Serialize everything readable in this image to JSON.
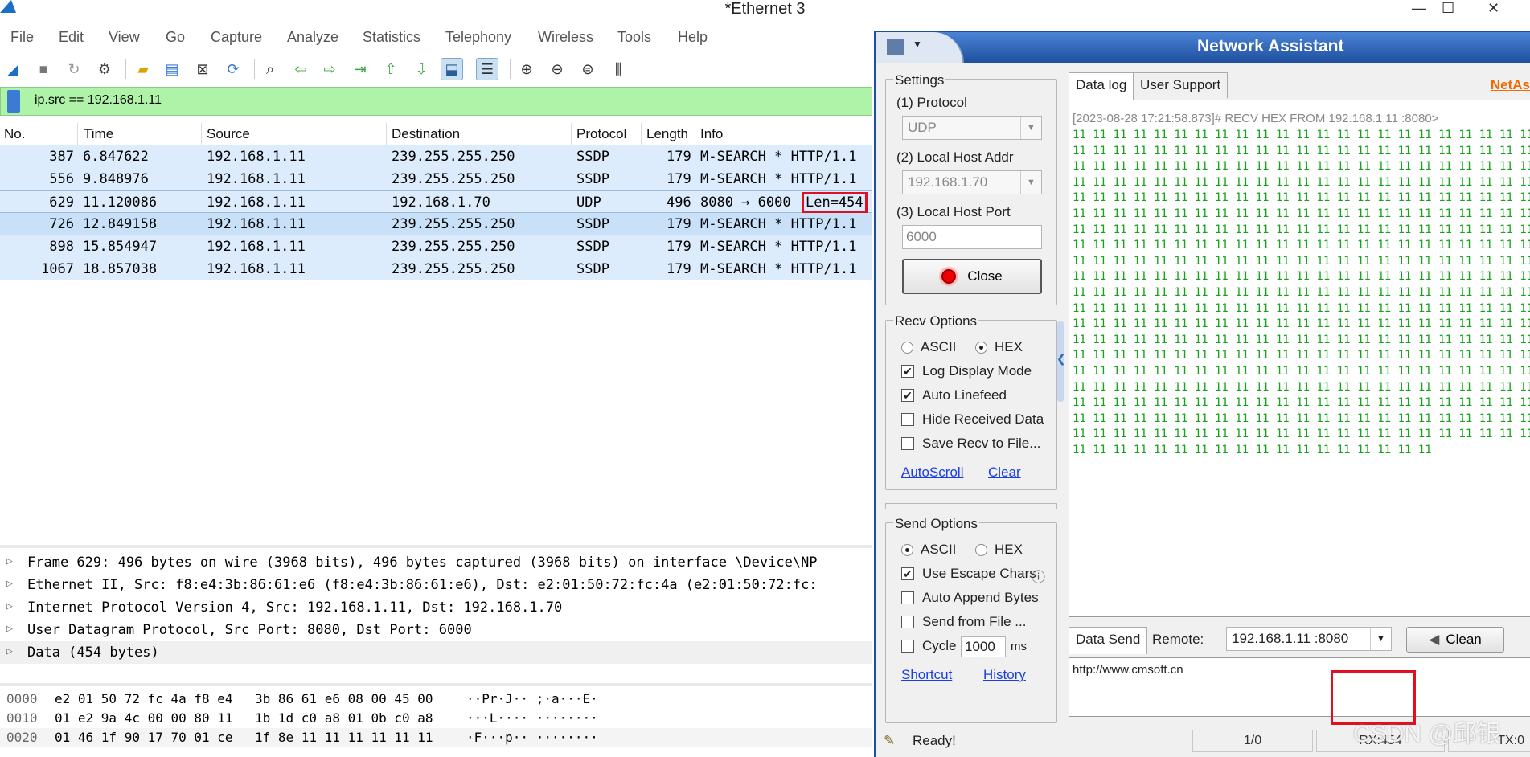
{
  "wireshark": {
    "title": "*Ethernet 3",
    "window_controls": [
      "—",
      "☐",
      "✕"
    ],
    "menu": [
      "File",
      "Edit",
      "View",
      "Go",
      "Capture",
      "Analyze",
      "Statistics",
      "Telephony",
      "Wireless",
      "Tools",
      "Help"
    ],
    "filter": "ip.src == 192.168.1.11",
    "columns": [
      "No.",
      "Time",
      "Source",
      "Destination",
      "Protocol",
      "Length",
      "Info"
    ],
    "packets": [
      {
        "no": "387",
        "time": "6.847622",
        "src": "192.168.1.11",
        "dst": "239.255.255.250",
        "proto": "SSDP",
        "len": "179",
        "info": "M-SEARCH * HTTP/1.1",
        "info_extra": ""
      },
      {
        "no": "556",
        "time": "9.848976",
        "src": "192.168.1.11",
        "dst": "239.255.255.250",
        "proto": "SSDP",
        "len": "179",
        "info": "M-SEARCH * HTTP/1.1",
        "info_extra": ""
      },
      {
        "no": "629",
        "time": "11.120086",
        "src": "192.168.1.11",
        "dst": "192.168.1.70",
        "proto": "UDP",
        "len": "496",
        "info": "8080 → 6000",
        "info_extra": "Len=454"
      },
      {
        "no": "726",
        "time": "12.849158",
        "src": "192.168.1.11",
        "dst": "239.255.255.250",
        "proto": "SSDP",
        "len": "179",
        "info": "M-SEARCH * HTTP/1.1",
        "info_extra": ""
      },
      {
        "no": "898",
        "time": "15.854947",
        "src": "192.168.1.11",
        "dst": "239.255.255.250",
        "proto": "SSDP",
        "len": "179",
        "info": "M-SEARCH * HTTP/1.1",
        "info_extra": ""
      },
      {
        "no": "1067",
        "time": "18.857038",
        "src": "192.168.1.11",
        "dst": "239.255.255.250",
        "proto": "SSDP",
        "len": "179",
        "info": "M-SEARCH * HTTP/1.1",
        "info_extra": ""
      }
    ],
    "details": [
      "Frame 629: 496 bytes on wire (3968 bits), 496 bytes captured (3968 bits) on interface \\Device\\NP",
      "Ethernet II, Src: f8:e4:3b:86:61:e6 (f8:e4:3b:86:61:e6), Dst: e2:01:50:72:fc:4a (e2:01:50:72:fc:",
      "Internet Protocol Version 4, Src: 192.168.1.11, Dst: 192.168.1.70",
      "User Datagram Protocol, Src Port: 8080, Dst Port: 6000",
      "Data (454 bytes)"
    ],
    "hex": [
      {
        "off": "0000",
        "h1": "e2 01 50 72 fc 4a f8 e4",
        "h2": "3b 86 61 e6 08 00 45 00",
        "asc": "··Pr·J·· ;·a···E·"
      },
      {
        "off": "0010",
        "h1": "01 e2 9a 4c 00 00 80 11",
        "h2": "1b 1d c0 a8 01 0b c0 a8",
        "asc": "···L···· ········"
      },
      {
        "off": "0020",
        "h1": "01 46 1f 90 17 70 01 ce",
        "h2": "1f 8e 11 11 11 11 11 11",
        "asc": "·F···p·· ········"
      }
    ]
  },
  "assistant": {
    "title": "Network Assistant",
    "settings": {
      "group": "Settings",
      "protocol_label": "(1) Protocol",
      "protocol_value": "UDP",
      "local_addr_label": "(2) Local Host Addr",
      "local_addr_value": "192.168.1.70",
      "local_port_label": "(3) Local Host Port",
      "local_port_value": "6000",
      "close_button": "Close"
    },
    "recv": {
      "group": "Recv Options",
      "ascii": "ASCII",
      "hex": "HEX",
      "log_display": "Log Display Mode",
      "auto_linefeed": "Auto Linefeed",
      "hide_received": "Hide Received Data",
      "save_recv": "Save Recv to File...",
      "autoscroll": "AutoScroll",
      "clear": "Clear"
    },
    "send": {
      "group": "Send Options",
      "ascii": "ASCII",
      "hex": "HEX",
      "use_escape": "Use Escape Chars",
      "info_icon": "ⓘ",
      "auto_append": "Auto Append Bytes",
      "send_from_file": "Send from File ...",
      "cycle": "Cycle",
      "cycle_value": "1000",
      "cycle_unit": "ms",
      "shortcut": "Shortcut",
      "history": "History"
    },
    "tabs": [
      "Data log",
      "User Support"
    ],
    "netassist_link": "NetAs",
    "log_header": "[2023-08-28 17:21:58.873]# RECV HEX FROM 192.168.1.11 :8080>",
    "log_data": "11 11 11 11 11 11 11 11 11 11 11 11 11 11 11 11 11 11 11 11 11 11 11 11 11 11 11 11 11 11 11 11 11 11 11 11 11 11 11 11 11 11 11 11 11 11 11 11 11 11 11 11 11 11 11 11 11 11 11 11 11 11 11 11 11 11 11 11 11 11 11 11 11 11 11 11 11 11 11 11 11 11 11 11 11 11 11 11 11 11 11 11 11 11 11 11 11 11 11 11 11 11 11 11 11 11 11 11 11 11 11 11 11 11 11 11 11 11 11 11 11 11 11 11 11 11 11 11 11 11 11 11 11 11 11 11 11 11 11 11 11 11 11 11 11 11 11 11 11 11 11 11 11 11 11 11 11 11 11 11 11 11 11 11 11 11 11 11 11 11 11 11 11 11 11 11 11 11 11 11 11 11 11 11 11 11 11 11 11 11 11 11 11 11 11 11 11 11 11 11 11 11 11 11 11 11 11 11 11 11 11 11 11 11 11 11 11 11 11 11 11 11 11 11 11 11 11 11 11 11 11 11 11 11 11 11 11 11 11 11 11 11 11 11 11 11 11 11 11 11 11 11 11 11 11 11 11 11 11 11 11 11 11 11 11 11 11 11 11 11 11 11 11 11 11 11 11 11 11 11 11 11 11 11 11 11 11 11 11 11 11 11 11 11 11 11 11 11 11 11 11 11 11 11 11 11 11 11 11 11 11 11 11 11 11 11 11 11 11 11 11 11 11 11 11 11 11 11 11 11 11 11 11 11 11 11 11 11 11 11 11 11 11 11 11 11 11 11 11 11 11 11 11 11 11 11 11 11 11 11 11 11 11 11 11 11 11 11 11 11 11 11 11 11 11 11 11 11 11 11 11 11 11 11 11 11 11 11 11 11 11 11 11 11 11 11 11 11 11 11 11 11 11 11 11 11 11 11 11 11 11 11 11 11 11 11 11 11 11 11 11 11 11 11 11 11 11 11 11 11 11 11 11 11 11 11 11 11 11 11 11 11 11 11 11 11 11 11 11 11 11 11 11 11 11 11 11 11 11 11 11 11 11 11 11 11 11 11 11 11 11 11 11 11 11 11 11 11 11 11 11 11 11 11 11 11 11 11 11 11 11 11 11 11 11 11 11 11",
    "send_bar": {
      "data_send": "Data Send",
      "remote_label": "Remote:",
      "remote_value": "192.168.1.11 :8080",
      "clean": "Clean"
    },
    "send_text": "http://www.cmsoft.cn",
    "status": {
      "ready": "Ready!",
      "count": "1/0",
      "rx": "RX:454",
      "tx": "TX:0"
    }
  },
  "watermark": "CSDN @邱银"
}
